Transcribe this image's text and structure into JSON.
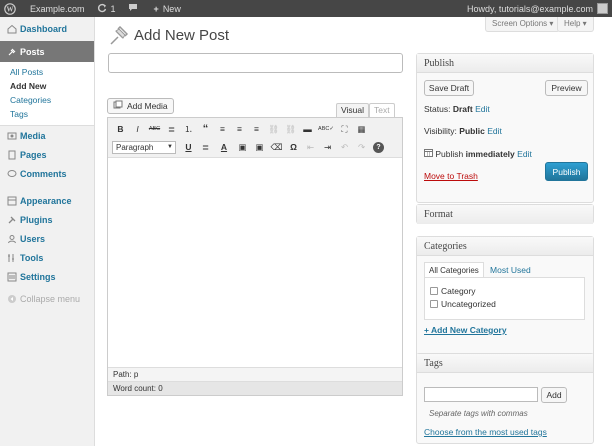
{
  "admin_bar": {
    "site_name": "Example.com",
    "updates_count": "1",
    "new_label": "New",
    "howdy": "Howdy, tutorials@example.com"
  },
  "sidebar": {
    "dashboard": "Dashboard",
    "posts": "Posts",
    "posts_sub": [
      "All Posts",
      "Add New",
      "Categories",
      "Tags"
    ],
    "media": "Media",
    "pages": "Pages",
    "comments": "Comments",
    "appearance": "Appearance",
    "plugins": "Plugins",
    "users": "Users",
    "tools": "Tools",
    "settings": "Settings",
    "collapse": "Collapse menu"
  },
  "header": {
    "title": "Add New Post",
    "screen_options": "Screen Options ▾",
    "help": "Help ▾"
  },
  "editor": {
    "add_media": "Add Media",
    "tab_visual": "Visual",
    "tab_text": "Text",
    "format_select": "Paragraph",
    "path": "Path: p",
    "word_count": "Word count: 0",
    "toolbar_row1": [
      "B",
      "I",
      "ABC",
      "≣",
      "⒈",
      "“",
      "≡",
      "≡",
      "≡",
      "⛓",
      "⛓",
      "▬",
      "ABC✓",
      "⛶",
      "▦"
    ],
    "toolbar_row2": [
      "U",
      "≣",
      "A",
      "▣",
      "▣",
      "⌫",
      "Ω",
      "⇤",
      "⇥",
      "↶",
      "↷",
      "?"
    ]
  },
  "publish_box": {
    "title": "Publish",
    "save_draft": "Save Draft",
    "preview": "Preview",
    "status_label": "Status:",
    "status_value": "Draft",
    "visibility_label": "Visibility:",
    "visibility_value": "Public",
    "publish_label": "Publish",
    "publish_value": "immediately",
    "edit": "Edit",
    "move_to_trash": "Move to Trash",
    "publish_button": "Publish"
  },
  "format_box": {
    "title": "Format"
  },
  "categories_box": {
    "title": "Categories",
    "tab_all": "All Categories",
    "tab_most_used": "Most Used",
    "items": [
      "Category",
      "Uncategorized"
    ],
    "add_new": "+ Add New Category"
  },
  "tags_box": {
    "title": "Tags",
    "add_button": "Add",
    "hint": "Separate tags with commas",
    "choose_link": "Choose from the most used tags"
  },
  "colors": {
    "admin_bar": "#464646",
    "link": "#21759b",
    "primary_button": "#21759b",
    "trash": "#bc0b0b"
  }
}
